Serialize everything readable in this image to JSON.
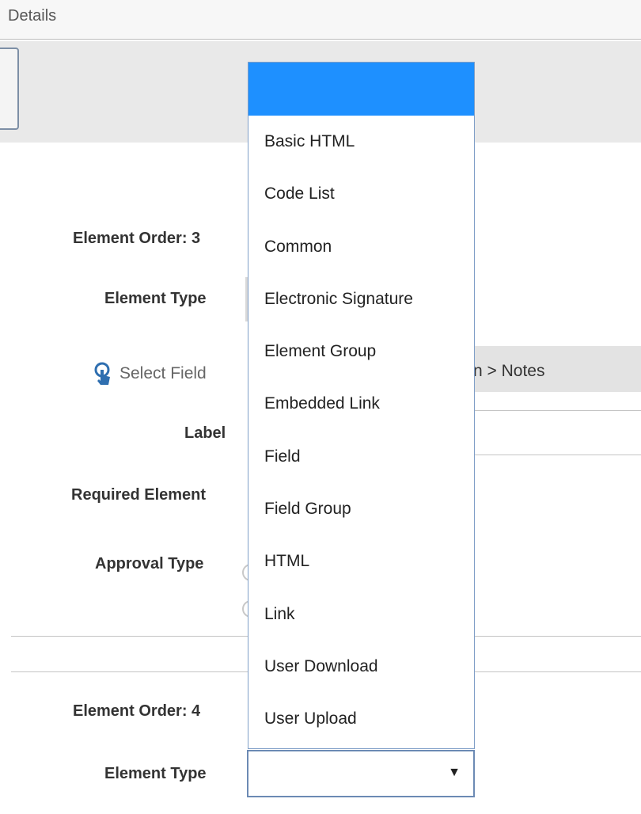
{
  "tab": {
    "title": "Details"
  },
  "elements": [
    {
      "order_label": "Element Order: 3",
      "type_label": "Element Type",
      "select_field_label": "Select Field",
      "field_path": "n > Notes",
      "label_label": "Label",
      "required_label": "Required Element",
      "approval_label": "Approval Type"
    },
    {
      "order_label": "Element Order: 4",
      "type_label": "Element Type",
      "type_value": ""
    }
  ],
  "dropdown": {
    "selected": "",
    "options": [
      "Basic HTML",
      "Code List",
      "Common",
      "Electronic Signature",
      "Element Group",
      "Embedded Link",
      "Field",
      "Field Group",
      "HTML",
      "Link",
      "User Download",
      "User Upload"
    ]
  },
  "icons": {
    "select_field": "touch-pointer-icon",
    "select_arrow": "caret-down-icon",
    "select_arrow_glyph": "▼"
  },
  "colors": {
    "highlight": "#1e90ff",
    "select_border": "#6c8ab4"
  }
}
